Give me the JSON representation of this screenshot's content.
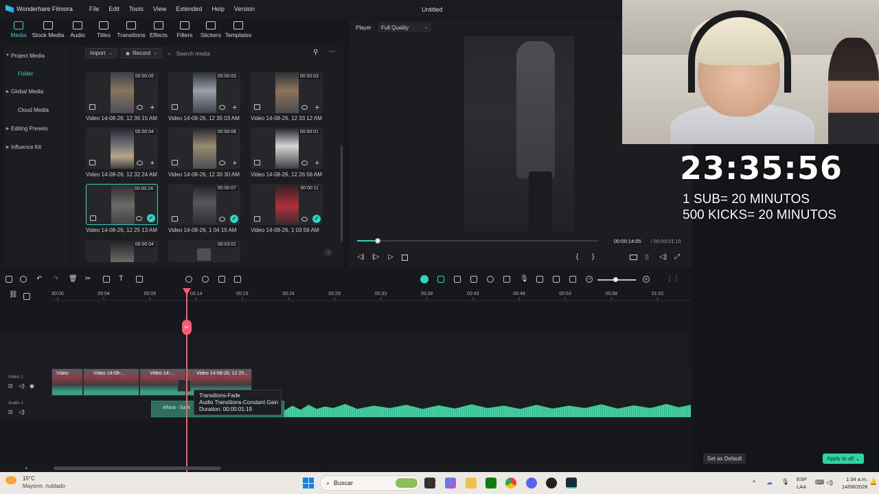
{
  "app": {
    "name": "Wonderhare Filmora",
    "window_title": "Untitled",
    "menu": [
      "File",
      "Edit",
      "Tools",
      "View",
      "Extended",
      "Help",
      "Version"
    ]
  },
  "toolbar": [
    "Media",
    "Stock Media",
    "Audio",
    "Titles",
    "Transitions",
    "Effects",
    "Filters",
    "Stickers",
    "Templates"
  ],
  "sidebar": [
    "Project Media",
    "Folder",
    "Global Media",
    "Cloud Media",
    "Editing Presets",
    "Influence Kit"
  ],
  "media": {
    "import_label": "Import",
    "record_label": "Record",
    "search_placeholder": "Search media",
    "items": [
      {
        "duration": "00:00:05",
        "name": "Video 14-08-26, 12 36 15 AM",
        "state": "plus"
      },
      {
        "duration": "00:00:03",
        "name": "Video 14-08-26, 12 35 03 AM",
        "state": "plus"
      },
      {
        "duration": "00:00:03",
        "name": "Video 14-08-26, 12 33 12 AM",
        "state": "plus"
      },
      {
        "duration": "00:00:04",
        "name": "Video 14-08-26, 12 32 24 AM",
        "state": "plus"
      },
      {
        "duration": "00:00:06",
        "name": "Video 14-08-26, 12 30 30 AM",
        "state": "plus"
      },
      {
        "duration": "00:00:01",
        "name": "Video 14-08-26, 12 26 56 AM",
        "state": "plus"
      },
      {
        "duration": "00:00:24",
        "name": "Video 14-08-26, 12 25 13 AM",
        "state": "check"
      },
      {
        "duration": "00:00:07",
        "name": "Video 14-08-26, 1 04 15 AM",
        "state": "check"
      },
      {
        "duration": "00:00:11",
        "name": "Video 14-08-26, 1 03 56 AM",
        "state": "check"
      },
      {
        "duration": "00:00:04",
        "name": "",
        "state": "none"
      },
      {
        "duration": "00:03:01",
        "name": "",
        "state": "none"
      }
    ]
  },
  "player": {
    "tab": "Player",
    "quality": "Full Quality",
    "current_time": "00:00:14:05",
    "total_time": "/ 00:03:01:15",
    "progress_fraction": 0.085
  },
  "timeline": {
    "ruler": [
      "00:00",
      "00:04",
      "00:09",
      "00:14",
      "00:19",
      "00:24",
      "00:29",
      "00:33",
      "00:38",
      "00:43",
      "00:48",
      "00:53",
      "00:58",
      "01:02"
    ],
    "tracks": {
      "video": "Video 1",
      "audio": "Audio 1"
    },
    "clips": [
      "Video",
      "Video 14-08-...",
      "Video 14-...",
      "Video 14-08-26, 12 25..."
    ],
    "audio_clip": "Añora - Sarit",
    "tooltip": {
      "line1": "Transitions-Fade",
      "line2": "Audio Transitions-Constant Gain",
      "line3": "Duration: 00:00:01:19"
    }
  },
  "overlay": {
    "clock": "23:35:56",
    "rule1": "1 SUB= 20 MINUTOS",
    "rule2": "500 KICKS= 20 MINUTOS"
  },
  "panel": {
    "set_default": "Set as Default",
    "apply_all": "Apply to all"
  },
  "taskbar": {
    "weather_temp": "15°C",
    "weather_desc": "Mayorm. nublado",
    "search": "Buscar",
    "lang1": "ESP",
    "lang2": "LAA",
    "time": "1:34 a.m.",
    "date": "14/08/2026"
  }
}
